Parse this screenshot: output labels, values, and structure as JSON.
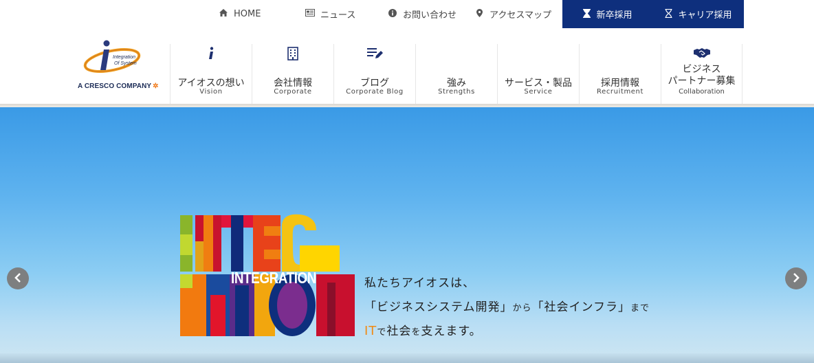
{
  "topbar": {
    "links": [
      {
        "label": "HOME",
        "icon": "home-icon"
      },
      {
        "label": "ニュース",
        "icon": "newspaper-icon"
      },
      {
        "label": "お問い合わせ",
        "icon": "info-icon"
      },
      {
        "label": "アクセスマップ",
        "icon": "map-pin-icon"
      }
    ],
    "recruit": [
      {
        "label": "新卒採用",
        "icon": "hourglass-icon"
      },
      {
        "label": "キャリア採用",
        "icon": "hourglass-outline-icon"
      }
    ],
    "recruit_bg": "#0e2f7d"
  },
  "logo": {
    "mark_text_1": "Integration",
    "mark_text_2": "Of System",
    "caption": "A CRESCO COMPANY",
    "accent": "#f07a1a"
  },
  "nav": {
    "items": [
      {
        "jp": "アイオスの想い",
        "en": "Vision",
        "icon": "info-i-icon"
      },
      {
        "jp": "会社情報",
        "en": "Corporate",
        "icon": "building-icon"
      },
      {
        "jp": "ブログ",
        "en": "Corporate Blog",
        "icon": "edit-list-icon"
      },
      {
        "jp": "強み",
        "en": "Strengths",
        "icon": ""
      },
      {
        "jp": "サービス・製品",
        "en": "Service",
        "icon": ""
      },
      {
        "jp": "採用情報",
        "en": "Recruitment",
        "icon": ""
      },
      {
        "jp_line1": "ビジネス",
        "jp_line2": "パートナー募集",
        "en": "Collaboration",
        "icon": "handshake-icon"
      }
    ],
    "text_color": "#1d2f6f"
  },
  "hero": {
    "mosaic_text": "INTEGRATION",
    "tagline_1": "私たちアイオスは、",
    "tagline_2_a": "「ビジネスシステム開発」",
    "tagline_2_b": "から",
    "tagline_2_c": "「社会インフラ」",
    "tagline_2_d": "まで",
    "tagline_3_a": "IT",
    "tagline_3_b": "で",
    "tagline_3_c": "社会",
    "tagline_3_d": "を",
    "tagline_3_e": "支えます。",
    "accent_color": "#f08a14",
    "prev_icon": "chevron-left-icon",
    "next_icon": "chevron-right-icon"
  }
}
